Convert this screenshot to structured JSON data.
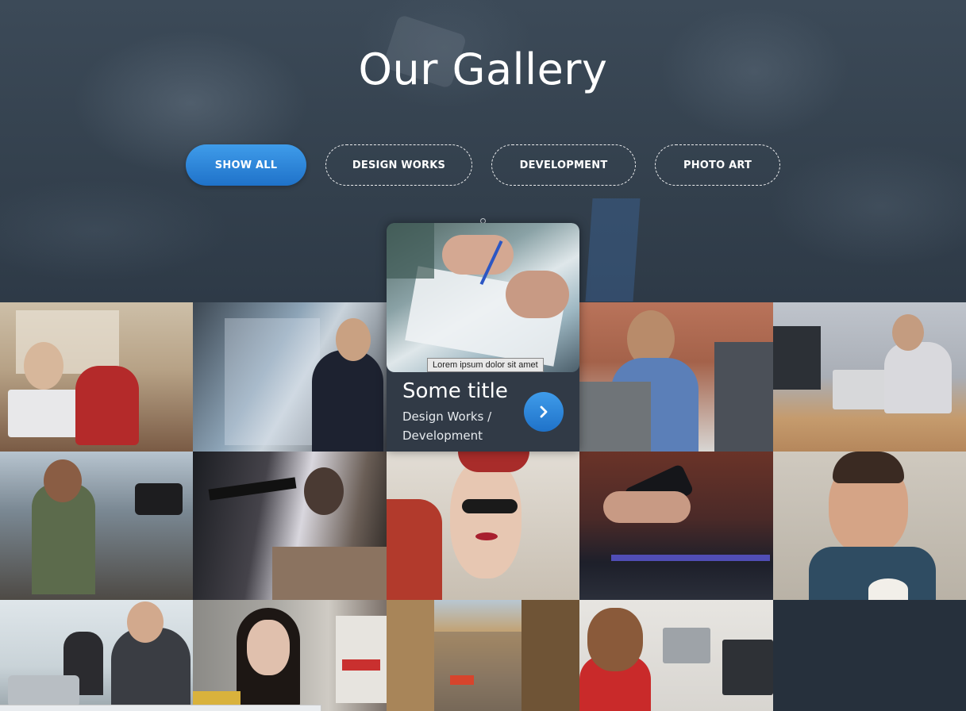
{
  "hero": {
    "title": "Our Gallery"
  },
  "filters": [
    {
      "label": "SHOW ALL",
      "active": true
    },
    {
      "label": "DESIGN WORKS",
      "active": false
    },
    {
      "label": "DEVELOPMENT",
      "active": false
    },
    {
      "label": "PHOTO ART",
      "active": false
    }
  ],
  "featured": {
    "tooltip": "Lorem ipsum dolor sit amet",
    "title": "Some title",
    "category": "Design Works / Development",
    "button_icon": "chevron-right-icon"
  },
  "gallery": {
    "tiles": [
      {
        "subject": "kids-with-laptop"
      },
      {
        "subject": "businessman-with-phone"
      },
      {
        "subject": "developers-at-laptops"
      },
      {
        "subject": "man-with-headphones-at-desk"
      },
      {
        "subject": "protest-photographers"
      },
      {
        "subject": "woman-aiming-gun"
      },
      {
        "subject": "woman-with-sunglasses"
      },
      {
        "subject": "hands-with-smartphone"
      },
      {
        "subject": "smiling-man-in-office"
      },
      {
        "subject": "man-presenting"
      },
      {
        "subject": "woman-in-city-street"
      },
      {
        "subject": "city-street-buildings"
      },
      {
        "subject": "boy-with-laptop"
      }
    ]
  },
  "colors": {
    "accent": "#2a86dc",
    "background": "#26303c",
    "card": "#313a46"
  }
}
